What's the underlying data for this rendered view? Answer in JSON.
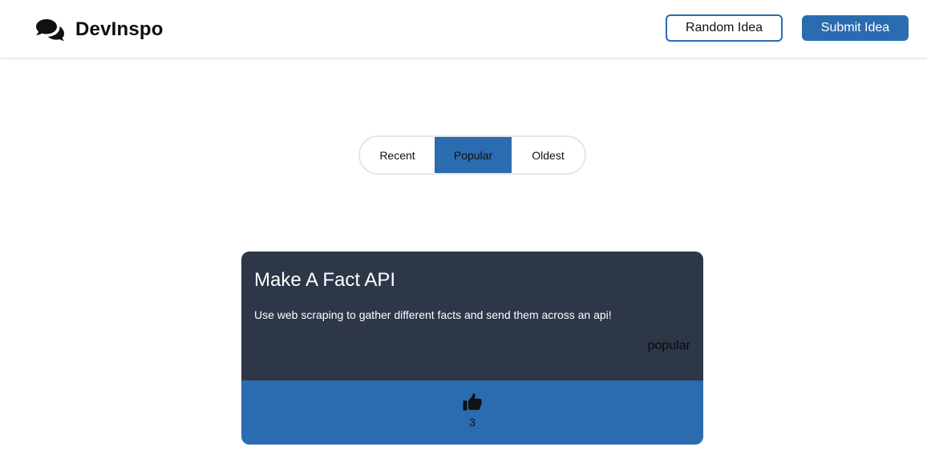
{
  "header": {
    "brand_name": "DevInspo",
    "brand_icon": "comments-icon",
    "random_label": "Random Idea",
    "submit_label": "Submit Idea"
  },
  "tabs": [
    {
      "label": "Recent",
      "active": false
    },
    {
      "label": "Popular",
      "active": true
    },
    {
      "label": "Oldest",
      "active": false
    }
  ],
  "ideas": [
    {
      "title": "Make A Fact API",
      "description": "Use web scraping to gather different facts and send them across an api!",
      "tag": "popular",
      "likes": "3",
      "like_icon": "thumbs-up-icon"
    }
  ],
  "colors": {
    "accent": "#2b6cb0",
    "card_bg": "#2d3748",
    "header_border": "#e3e3e3"
  }
}
